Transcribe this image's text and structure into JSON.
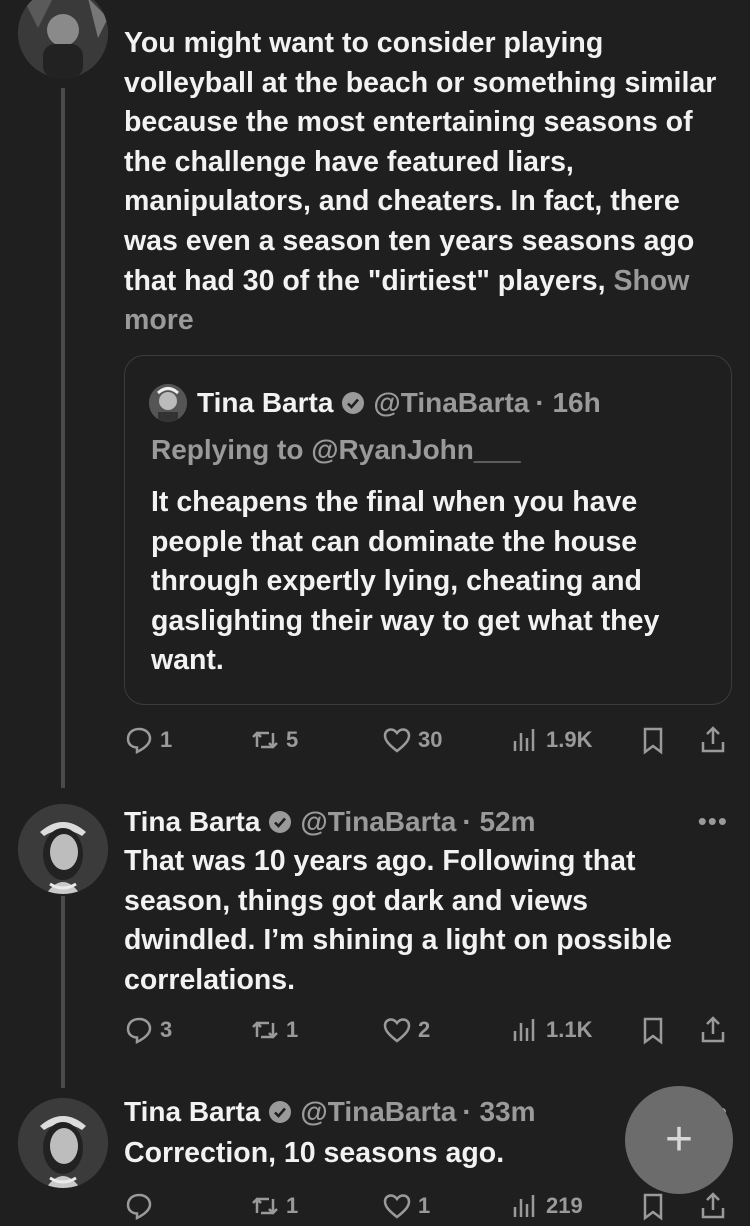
{
  "tweet1": {
    "body": "You might want to consider playing volleyball at the beach or something similar because the most entertaining seasons of the challenge have featured liars, manipulators, and cheaters. In fact, there was even a season ten years seasons ago that had 30 of the \"dirtiest\" players,",
    "show_more": "Show more",
    "quote": {
      "name": "Tina Barta",
      "handle": "@TinaBarta",
      "time": "· 16h",
      "replying": "Replying to @RyanJohn___",
      "text": "It cheapens the final when you have people that can dominate the house through expertly lying, cheating and gaslighting their way to get what they want."
    },
    "stats": {
      "replies": "1",
      "reposts": "5",
      "likes": "30",
      "views": "1.9K"
    }
  },
  "tweet2": {
    "name": "Tina Barta",
    "handle": "@TinaBarta",
    "time": "· 52m",
    "body": "That was 10 years ago.  Following that season, things got dark and views dwindled.  I’m shining a light on possible correlations.",
    "stats": {
      "replies": "3",
      "reposts": "1",
      "likes": "2",
      "views": "1.1K"
    }
  },
  "tweet3": {
    "name": "Tina Barta",
    "handle": "@TinaBarta",
    "time": "· 33m",
    "body": "Correction, 10 seasons ago.",
    "stats": {
      "replies": "",
      "reposts": "1",
      "likes": "1",
      "views": "219"
    }
  },
  "more_label": "•••",
  "compose_label": "+"
}
